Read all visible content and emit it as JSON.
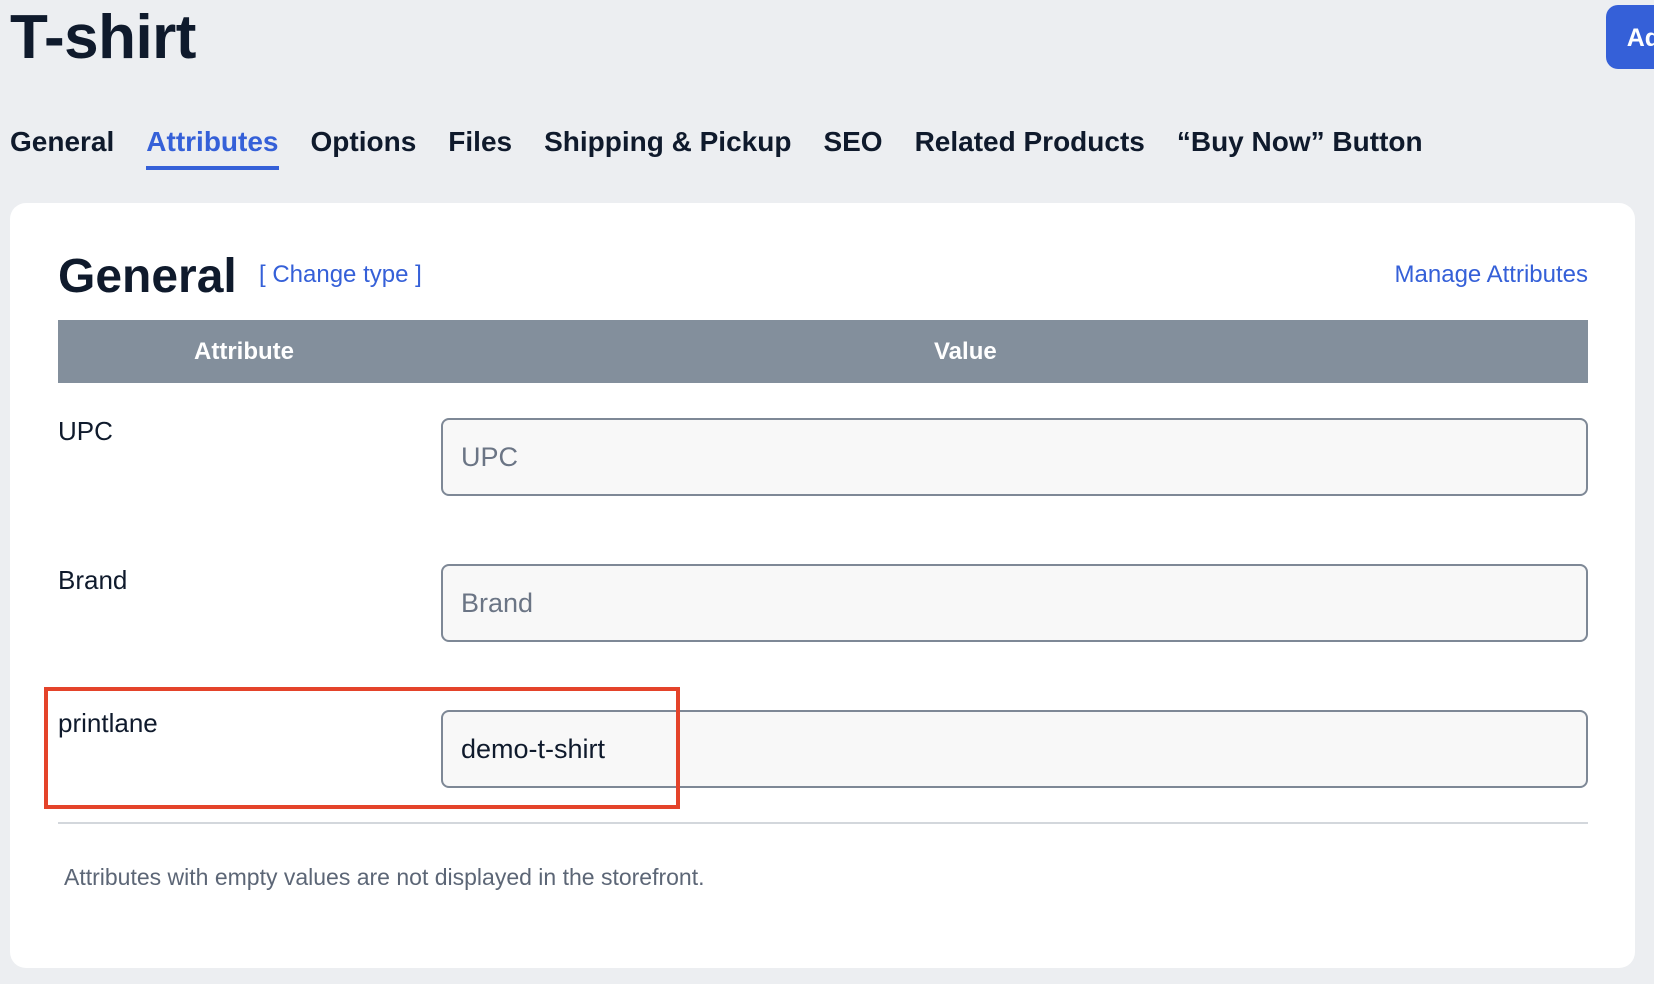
{
  "page": {
    "title": "T-shirt",
    "add_button_label": "Add"
  },
  "tabs": [
    {
      "label": "General",
      "active": false
    },
    {
      "label": "Attributes",
      "active": true
    },
    {
      "label": "Options",
      "active": false
    },
    {
      "label": "Files",
      "active": false
    },
    {
      "label": "Shipping & Pickup",
      "active": false
    },
    {
      "label": "SEO",
      "active": false
    },
    {
      "label": "Related Products",
      "active": false
    },
    {
      "label": "“Buy Now” Button",
      "active": false
    }
  ],
  "card": {
    "title": "General",
    "change_type_link": "[ Change type ]",
    "manage_link": "Manage Attributes",
    "columns": {
      "attribute": "Attribute",
      "value": "Value"
    },
    "rows": [
      {
        "label": "UPC",
        "value": "",
        "placeholder": "UPC"
      },
      {
        "label": "Brand",
        "value": "",
        "placeholder": "Brand"
      },
      {
        "label": "printlane",
        "value": "demo-t-shirt",
        "placeholder": ""
      }
    ],
    "note": "Attributes with empty values are not displayed in the storefront."
  },
  "colors": {
    "accent": "#3560d8",
    "header_bg": "#838f9c",
    "highlight": "#e4432a",
    "page_bg": "#eceef1"
  }
}
